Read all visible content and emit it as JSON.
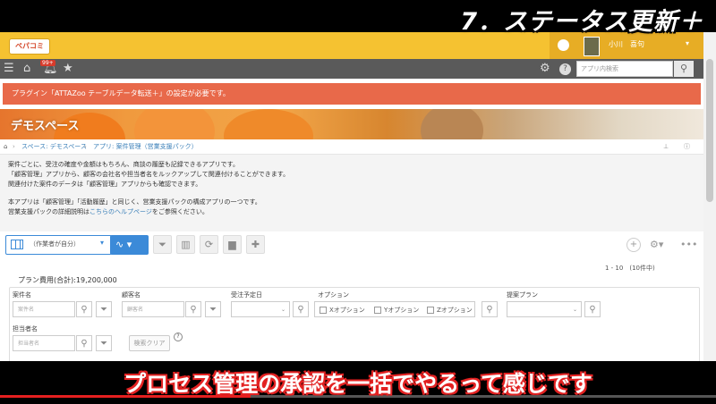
{
  "overlay": {
    "title": "7．ステータス更新＋",
    "subtitle": "プロセス管理の承認を一括でやるって感じです"
  },
  "colors": {
    "topbar": "#f5c231",
    "nav": "#5a5a5a",
    "alert": "#e8694a",
    "accent": "#3b8ad8",
    "subtitle_outline": "#e32222"
  },
  "header": {
    "logo_text": "ペパコミ",
    "user_name": "小川　喜句",
    "home_icon": "home-circle-icon",
    "user_caret": "▾"
  },
  "nav": {
    "badge": "99+",
    "icons": [
      "menu-icon",
      "home-icon",
      "bell-icon",
      "star-icon",
      "gear-icon",
      "help-icon"
    ],
    "search_placeholder": "アプリ内検索"
  },
  "alert_text": "プラグイン「ATTAZoo テーブルデータ転送＋」の設定が必要です。",
  "space_title": "デモスペース",
  "breadcrumb": {
    "home": "⌂",
    "items": [
      "スペース: デモスペース",
      "アプリ: 案件管理（営業支援パック）"
    ]
  },
  "description": {
    "lines": [
      "案件ごとに、受注の確度や金額はもちろん、商談の履歴も記録できるアプリです。",
      "「顧客管理」アプリから、顧客の会社名や担当者名をルックアップして関連付けることができます。",
      "関連付けた案件のデータは「顧客管理」アプリからも確認できます。",
      "本アプリは「顧客管理」「活動履歴」と同じく、営業支援パックの構成アプリの一つです。"
    ],
    "help_prefix": "営業支援パックの詳細説明は",
    "help_link": "こちらのヘルプページ",
    "help_suffix": "をご参照ください。"
  },
  "toolbar": {
    "view_label": "（作業者が自分）",
    "graph_icon": "graph-icon",
    "tools": [
      "filter-icon",
      "chart-icon",
      "refresh-icon",
      "paint-roller-icon",
      "add-user-icon"
    ],
    "right_tools": [
      "add-icon",
      "gear-icon",
      "more-icon"
    ]
  },
  "pager": "1 - 10　(10件中)",
  "total": "プラン費用(合計):19,200,000",
  "filters": {
    "case_name_label": "案件名",
    "case_name_placeholder": "案件名",
    "customer_label": "顧客名",
    "customer_placeholder": "顧客名",
    "date_label": "受注予定日",
    "option_label": "オプション",
    "options": [
      "Xオプション",
      "Yオプション",
      "Zオプション"
    ],
    "plan_label": "提案プラン",
    "owner_label": "担当者名",
    "owner_placeholder": "担当者名",
    "clear_label": "検索クリア",
    "help_mark": "?"
  },
  "video": {
    "progress": 0.35
  }
}
